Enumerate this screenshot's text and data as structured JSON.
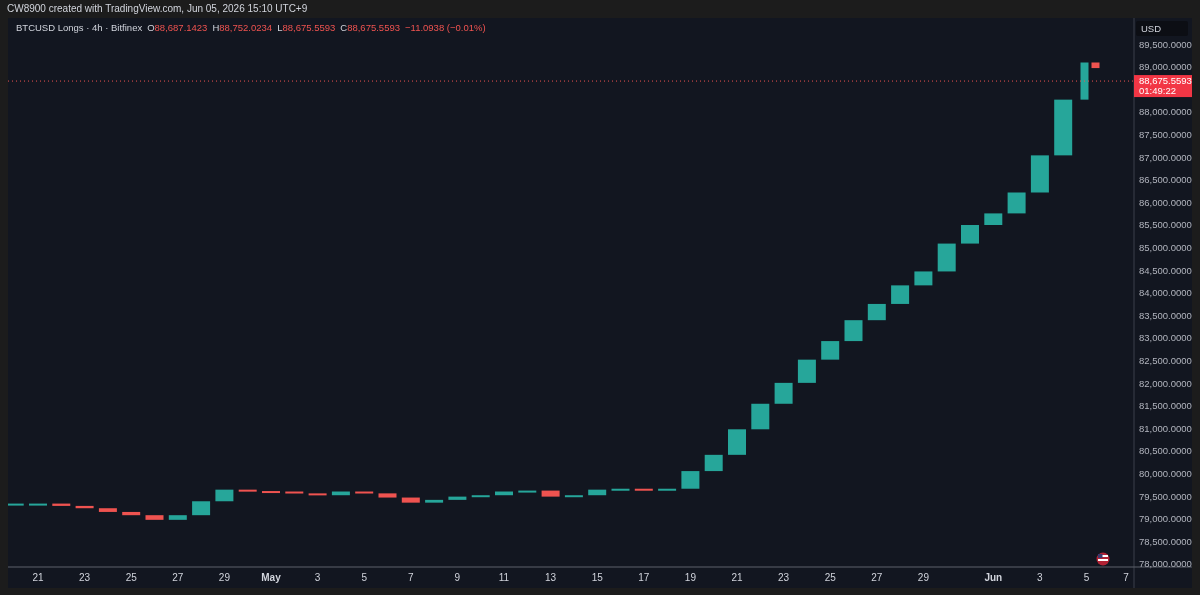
{
  "header": {
    "title": "CW8900 created with TradingView.com, Jun 05, 2026 15:10 UTC+9"
  },
  "chart": {
    "legend": {
      "symbol": "BTCUSD Longs · 4h · Bitfinex",
      "ohlc": [
        {
          "label": "O",
          "value": "88,687.1423"
        },
        {
          "label": "H",
          "value": "88,752.0234"
        },
        {
          "label": "L",
          "value": "88,675.5593"
        },
        {
          "label": "C",
          "value": "88,675.5593"
        }
      ],
      "change": "−11.0938 (−0.01%)"
    },
    "currency": "USD",
    "last_price": {
      "price": "88,675.5593",
      "countdown": "01:49:22"
    },
    "price_axis": [
      "89,500.0000",
      "89,000.0000",
      "88,000.0000",
      "87,500.0000",
      "87,000.0000",
      "86,500.0000",
      "86,000.0000",
      "85,500.0000",
      "85,000.0000",
      "84,500.0000",
      "84,000.0000",
      "83,500.0000",
      "83,000.0000",
      "82,500.0000",
      "82,000.0000",
      "81,500.0000",
      "81,000.0000",
      "80,500.0000",
      "80,000.0000",
      "79,500.0000",
      "79,000.0000",
      "78,500.0000",
      "78,000.0000"
    ],
    "time_axis": [
      "21",
      "23",
      "25",
      "27",
      "29",
      "May",
      "3",
      "5",
      "7",
      "9",
      "11",
      "13",
      "15",
      "17",
      "19",
      "21",
      "23",
      "25",
      "27",
      "29",
      "Jun",
      "3",
      "5",
      "7"
    ]
  }
}
